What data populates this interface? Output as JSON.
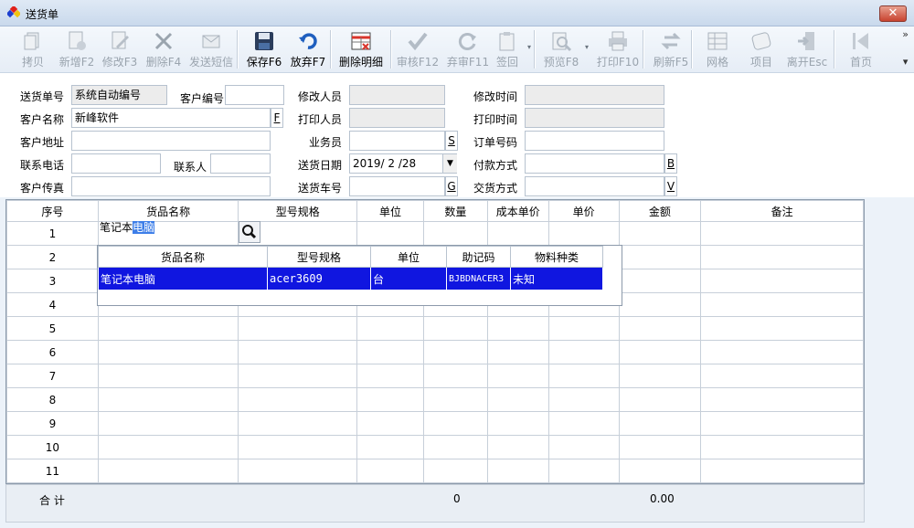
{
  "window": {
    "title": "送货单",
    "close_label": "✕"
  },
  "toolbar": [
    {
      "label": "拷贝",
      "icon": "copy-icon",
      "enabled": false
    },
    {
      "label": "新增F2",
      "icon": "new-doc-icon",
      "enabled": false
    },
    {
      "label": "修改F3",
      "icon": "edit-icon",
      "enabled": false
    },
    {
      "label": "删除F4",
      "icon": "delete-x-icon",
      "enabled": false
    },
    {
      "label": "发送短信",
      "icon": "sms-icon",
      "enabled": false
    },
    {
      "label": "保存F6",
      "icon": "save-icon",
      "enabled": true
    },
    {
      "label": "放弃F7",
      "icon": "undo-icon",
      "enabled": true
    },
    {
      "label": "删除明细",
      "icon": "delete-detail-icon",
      "enabled": true
    },
    {
      "label": "审核F12",
      "icon": "check-icon",
      "enabled": false
    },
    {
      "label": "弃审F11",
      "icon": "refresh-icon",
      "enabled": false
    },
    {
      "label": "签回",
      "icon": "clipboard-icon",
      "enabled": false
    },
    {
      "label": "预览F8",
      "icon": "preview-icon",
      "enabled": false
    },
    {
      "label": "打印F10",
      "icon": "printer-icon",
      "enabled": false
    },
    {
      "label": "刷新F5",
      "icon": "swap-icon",
      "enabled": false
    },
    {
      "label": "网格",
      "icon": "grid-icon",
      "enabled": false
    },
    {
      "label": "项目",
      "icon": "project-icon",
      "enabled": false
    },
    {
      "label": "离开Esc",
      "icon": "exit-icon",
      "enabled": false
    },
    {
      "label": "首页",
      "icon": "first-page-icon",
      "enabled": false
    }
  ],
  "form": {
    "delivery_no_label": "送货单号",
    "delivery_no": "系统自动编号",
    "customer_code_label": "客户编号",
    "customer_code": "",
    "modifier_label": "修改人员",
    "modifier": "",
    "modify_time_label": "修改时间",
    "modify_time": "",
    "customer_name_label": "客户名称",
    "customer_name": "新峰软件",
    "customer_name_key": "F",
    "printer_label": "打印人员",
    "printer": "",
    "print_time_label": "打印时间",
    "print_time": "",
    "address_label": "客户地址",
    "address": "",
    "salesman_label": "业务员",
    "salesman": "",
    "salesman_key": "S",
    "order_no_label": "订单号码",
    "order_no": "",
    "phone_label": "联系电话",
    "phone": "",
    "contact_label": "联系人",
    "contact": "",
    "delivery_date_label": "送货日期",
    "delivery_date": "2019/ 2 /28",
    "payment_label": "付款方式",
    "payment": "",
    "payment_key": "B",
    "fax_label": "客户传真",
    "fax": "",
    "vehicle_label": "送货车号",
    "vehicle": "",
    "vehicle_key": "G",
    "delivery_method_label": "交货方式",
    "delivery_method": "",
    "delivery_method_key": "V"
  },
  "grid": {
    "columns": [
      "序号",
      "货品名称",
      "型号规格",
      "单位",
      "数量",
      "成本单价",
      "单价",
      "金额",
      "备注"
    ],
    "rows": [
      "1",
      "2",
      "3",
      "4",
      "5",
      "6",
      "7",
      "8",
      "9",
      "10",
      "11"
    ],
    "editing_text_plain": "笔记本",
    "editing_text_selected": "电脑"
  },
  "popup": {
    "columns": [
      "货品名称",
      "型号规格",
      "单位",
      "助记码",
      "物料种类"
    ],
    "row": [
      "笔记本电脑",
      "acer3609",
      "台",
      "BJBDNACER3",
      "未知"
    ]
  },
  "totals": {
    "label": "合 计",
    "quantity": "0",
    "amount": "0.00"
  }
}
